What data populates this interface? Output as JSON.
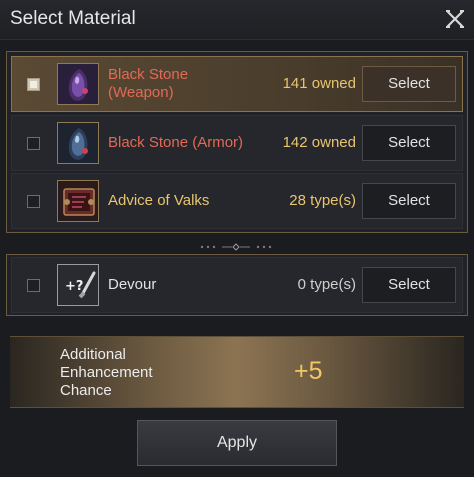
{
  "window": {
    "title": "Select Material",
    "close_icon": "close-x-icon"
  },
  "materials": [
    {
      "name_line1": "Black Stone",
      "name_line2": "(Weapon)",
      "count": "141 owned",
      "button": "Select",
      "icon": "black-stone-weapon-icon",
      "selected": true
    },
    {
      "name_line1": "Black Stone (Armor)",
      "count": "142 owned",
      "button": "Select",
      "icon": "black-stone-armor-icon",
      "selected": false
    },
    {
      "name_line1": "Advice of Valks",
      "count": "28 type(s)",
      "button": "Select",
      "icon": "advice-of-valks-icon",
      "selected": false
    }
  ],
  "extra": {
    "name": "Devour",
    "count": "0 type(s)",
    "button": "Select",
    "icon": "devour-icon",
    "selected": false
  },
  "enhancement": {
    "label": "Additional Enhancement Chance",
    "value": "+5"
  },
  "apply_label": "Apply",
  "colors": {
    "accent_gold": "#e8c56e",
    "name_red": "#e06a56",
    "border_gold": "#6a5a3e",
    "value_gold": "#f0c864"
  }
}
